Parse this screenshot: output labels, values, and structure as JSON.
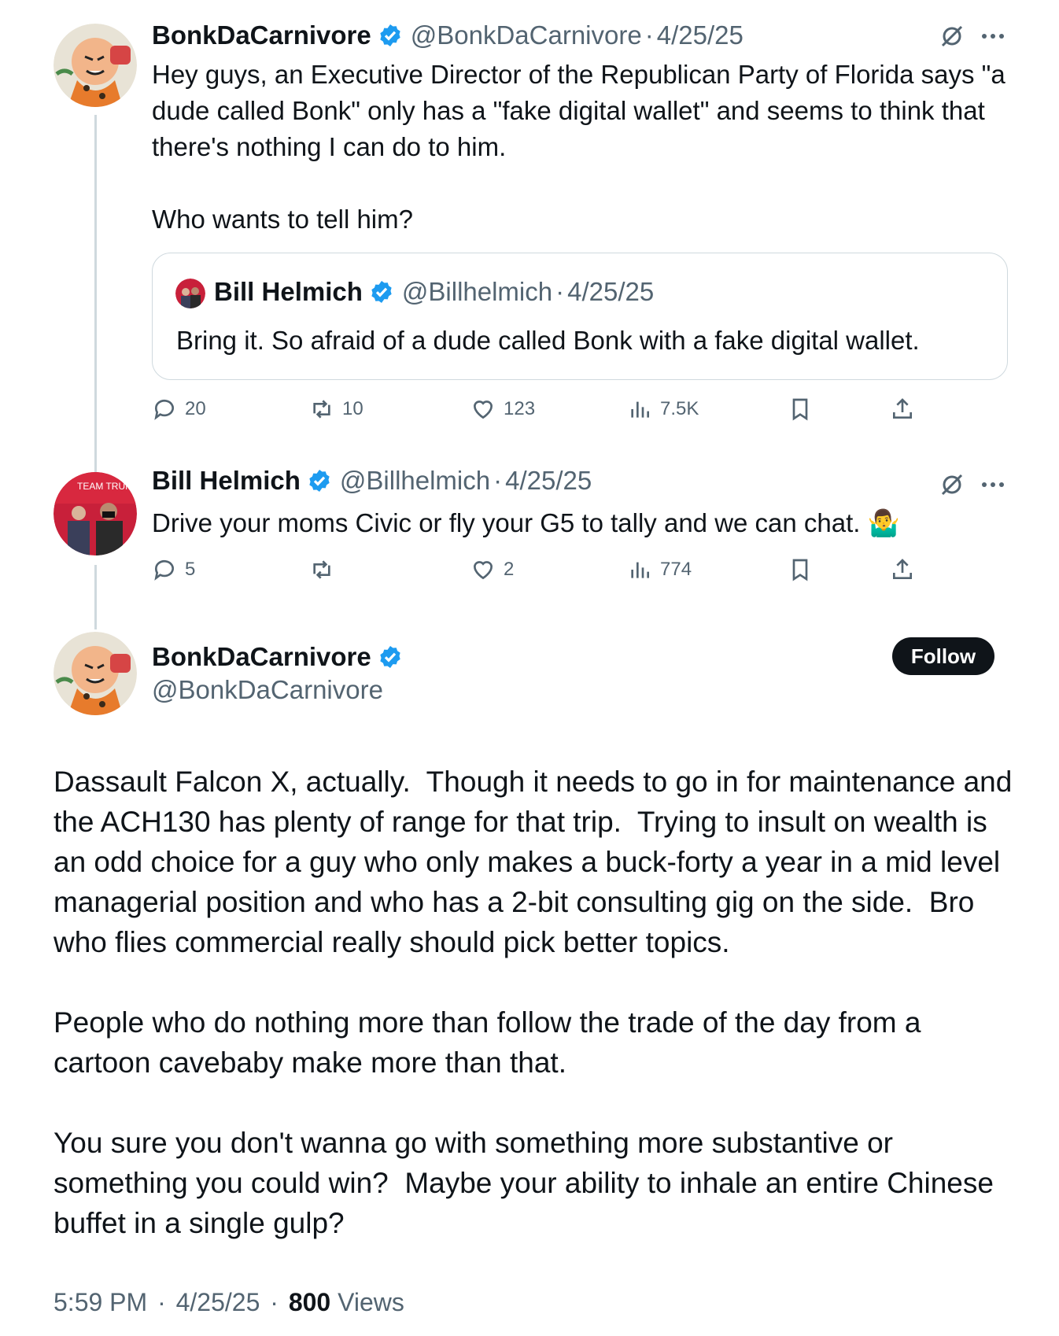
{
  "tweet1": {
    "display_name": "BonkDaCarnivore",
    "handle": "@BonkDaCarnivore",
    "separator": "·",
    "date": "4/25/25",
    "text": "Hey guys, an Executive Director of the Republican Party of Florida says \"a dude called Bonk\" only has a \"fake digital wallet\" and seems to think that there's nothing I can do to him.\n\nWho wants to tell him?",
    "quote": {
      "display_name": "Bill Helmich",
      "handle": "@Billhelmich",
      "separator": "·",
      "date": "4/25/25",
      "text": "Bring it. So afraid of a dude called Bonk with a fake digital wallet."
    },
    "stats": {
      "replies": "20",
      "reposts": "10",
      "likes": "123",
      "views": "7.5K"
    }
  },
  "tweet2": {
    "display_name": "Bill Helmich",
    "handle": "@Billhelmich",
    "separator": "·",
    "date": "4/25/25",
    "text": "Drive your moms Civic or fly your G5 to tally and we can chat. 🤷‍♂️",
    "avatar_text": "TEAM TRUMP",
    "stats": {
      "replies": "5",
      "reposts": "",
      "likes": "2",
      "views": "774"
    }
  },
  "main": {
    "display_name": "BonkDaCarnivore",
    "handle": "@BonkDaCarnivore",
    "follow_label": "Follow",
    "text": "Dassault Falcon X, actually.  Though it needs to go in for maintenance and the ACH130 has plenty of range for that trip.  Trying to insult on wealth is an odd choice for a guy who only makes a buck-forty a year in a mid level managerial position and who has a 2-bit consulting gig on the side.  Bro who flies commercial really should pick better topics.\n\nPeople who do nothing more than follow the trade of the day from a cartoon cavebaby make more than that.\n\nYou sure you don't wanna go with something more substantive or something you could win?  Maybe your ability to inhale an entire Chinese buffet in a single gulp?",
    "time": "5:59 PM",
    "date": "4/25/25",
    "separator": "·",
    "views_count": "800",
    "views_label": "Views"
  },
  "colors": {
    "verified": "#1d9bf0",
    "secondary_text": "#536471",
    "border": "#cfd9de",
    "primary_text": "#0f1419"
  },
  "icons": [
    "verified-badge-icon",
    "grok-icon",
    "more-icon",
    "reply-icon",
    "repost-icon",
    "like-icon",
    "views-icon",
    "bookmark-icon",
    "share-icon"
  ]
}
